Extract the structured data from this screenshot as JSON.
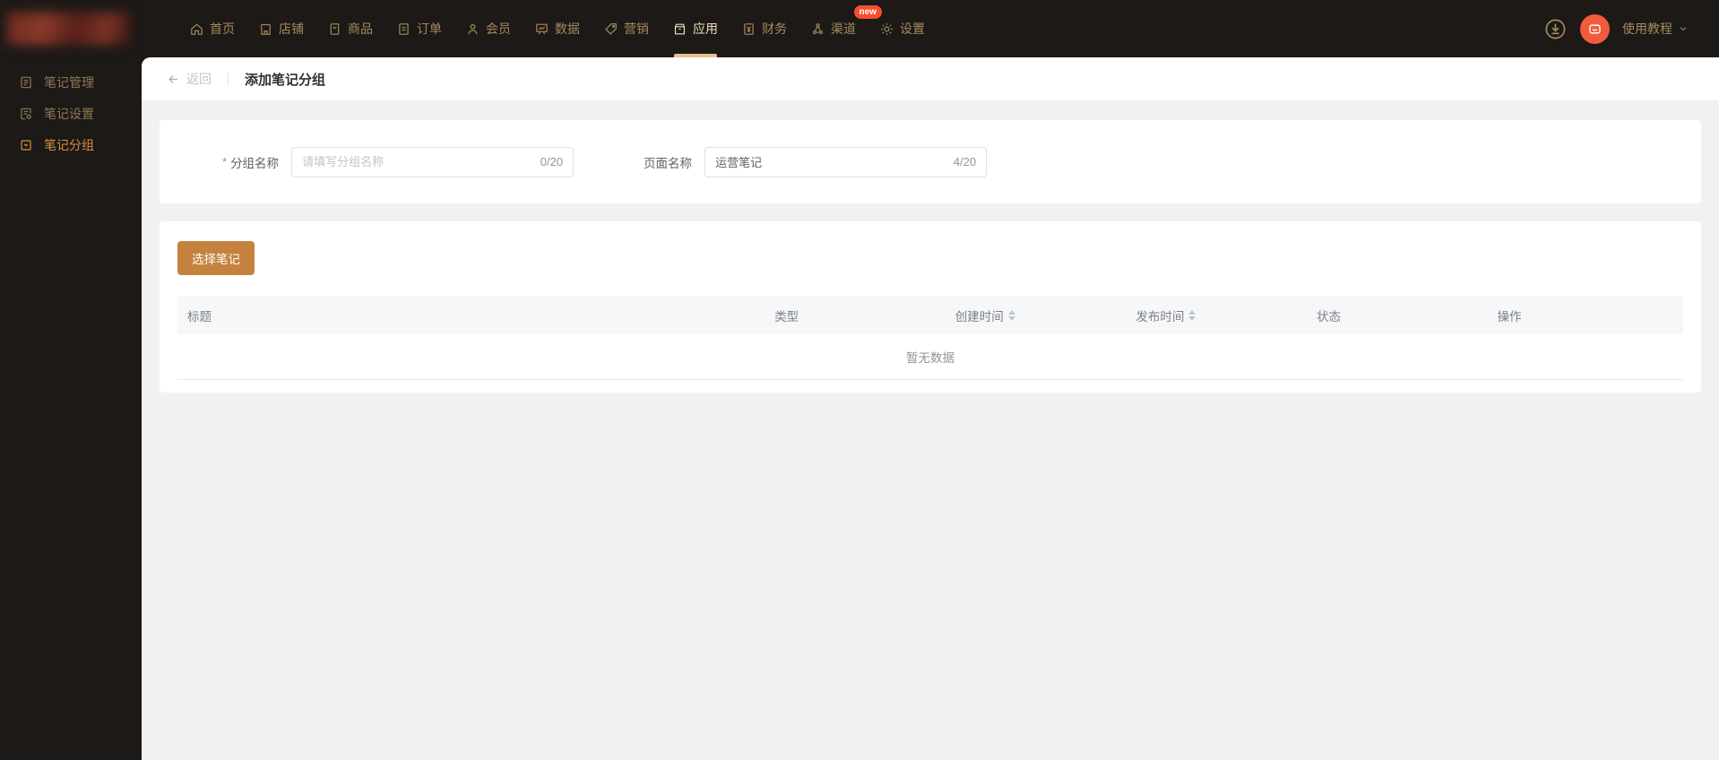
{
  "colors": {
    "navbar_bg": "#1c1917",
    "nav_text": "#a58a5b",
    "nav_active_text": "#f0ddbc",
    "active_underline": "#e8c08d",
    "new_badge_bg": "#f84e2f",
    "avatar_bg": "#f25a3c",
    "sidebar_active_text": "#d6913f",
    "primary_button_bg": "#c5823e",
    "main_bg": "#f0f1f2",
    "required_star": "#f56c6c"
  },
  "topnav": {
    "items": [
      {
        "label": "首页",
        "icon": "home-icon",
        "active": false
      },
      {
        "label": "店铺",
        "icon": "shop-icon",
        "active": false
      },
      {
        "label": "商品",
        "icon": "goods-icon",
        "active": false
      },
      {
        "label": "订单",
        "icon": "orders-icon",
        "active": false
      },
      {
        "label": "会员",
        "icon": "members-icon",
        "active": false
      },
      {
        "label": "数据",
        "icon": "data-icon",
        "active": false
      },
      {
        "label": "营销",
        "icon": "marketing-icon",
        "active": false
      },
      {
        "label": "应用",
        "icon": "apps-icon",
        "active": true
      },
      {
        "label": "财务",
        "icon": "finance-icon",
        "active": false
      },
      {
        "label": "渠道",
        "icon": "channels-icon",
        "active": false,
        "badge": "new"
      },
      {
        "label": "设置",
        "icon": "settings-icon",
        "active": false
      }
    ],
    "right": {
      "download_icon": "download-icon",
      "avatar_icon": "chat-avatar-icon",
      "tutorial_label": "使用教程",
      "chevron_icon": "chevron-down-icon"
    }
  },
  "sidebar": {
    "items": [
      {
        "label": "笔记管理",
        "icon": "note-management-icon",
        "active": false
      },
      {
        "label": "笔记设置",
        "icon": "note-settings-icon",
        "active": false
      },
      {
        "label": "笔记分组",
        "icon": "note-groups-icon",
        "active": true
      }
    ]
  },
  "page": {
    "back_label": "返回",
    "title": "添加笔记分组"
  },
  "form": {
    "group_name": {
      "label": "分组名称",
      "required": true,
      "placeholder": "请填写分组名称",
      "value": "",
      "counter": "0/20"
    },
    "page_name": {
      "label": "页面名称",
      "required": false,
      "value": "运营笔记",
      "counter": "4/20"
    }
  },
  "notes": {
    "select_button_label": "选择笔记",
    "table": {
      "columns": [
        {
          "label": "标题",
          "sortable": false
        },
        {
          "label": "类型",
          "sortable": false
        },
        {
          "label": "创建时间",
          "sortable": true
        },
        {
          "label": "发布时间",
          "sortable": true
        },
        {
          "label": "状态",
          "sortable": false
        },
        {
          "label": "操作",
          "sortable": false
        }
      ],
      "rows": [],
      "empty_text": "暂无数据"
    }
  }
}
